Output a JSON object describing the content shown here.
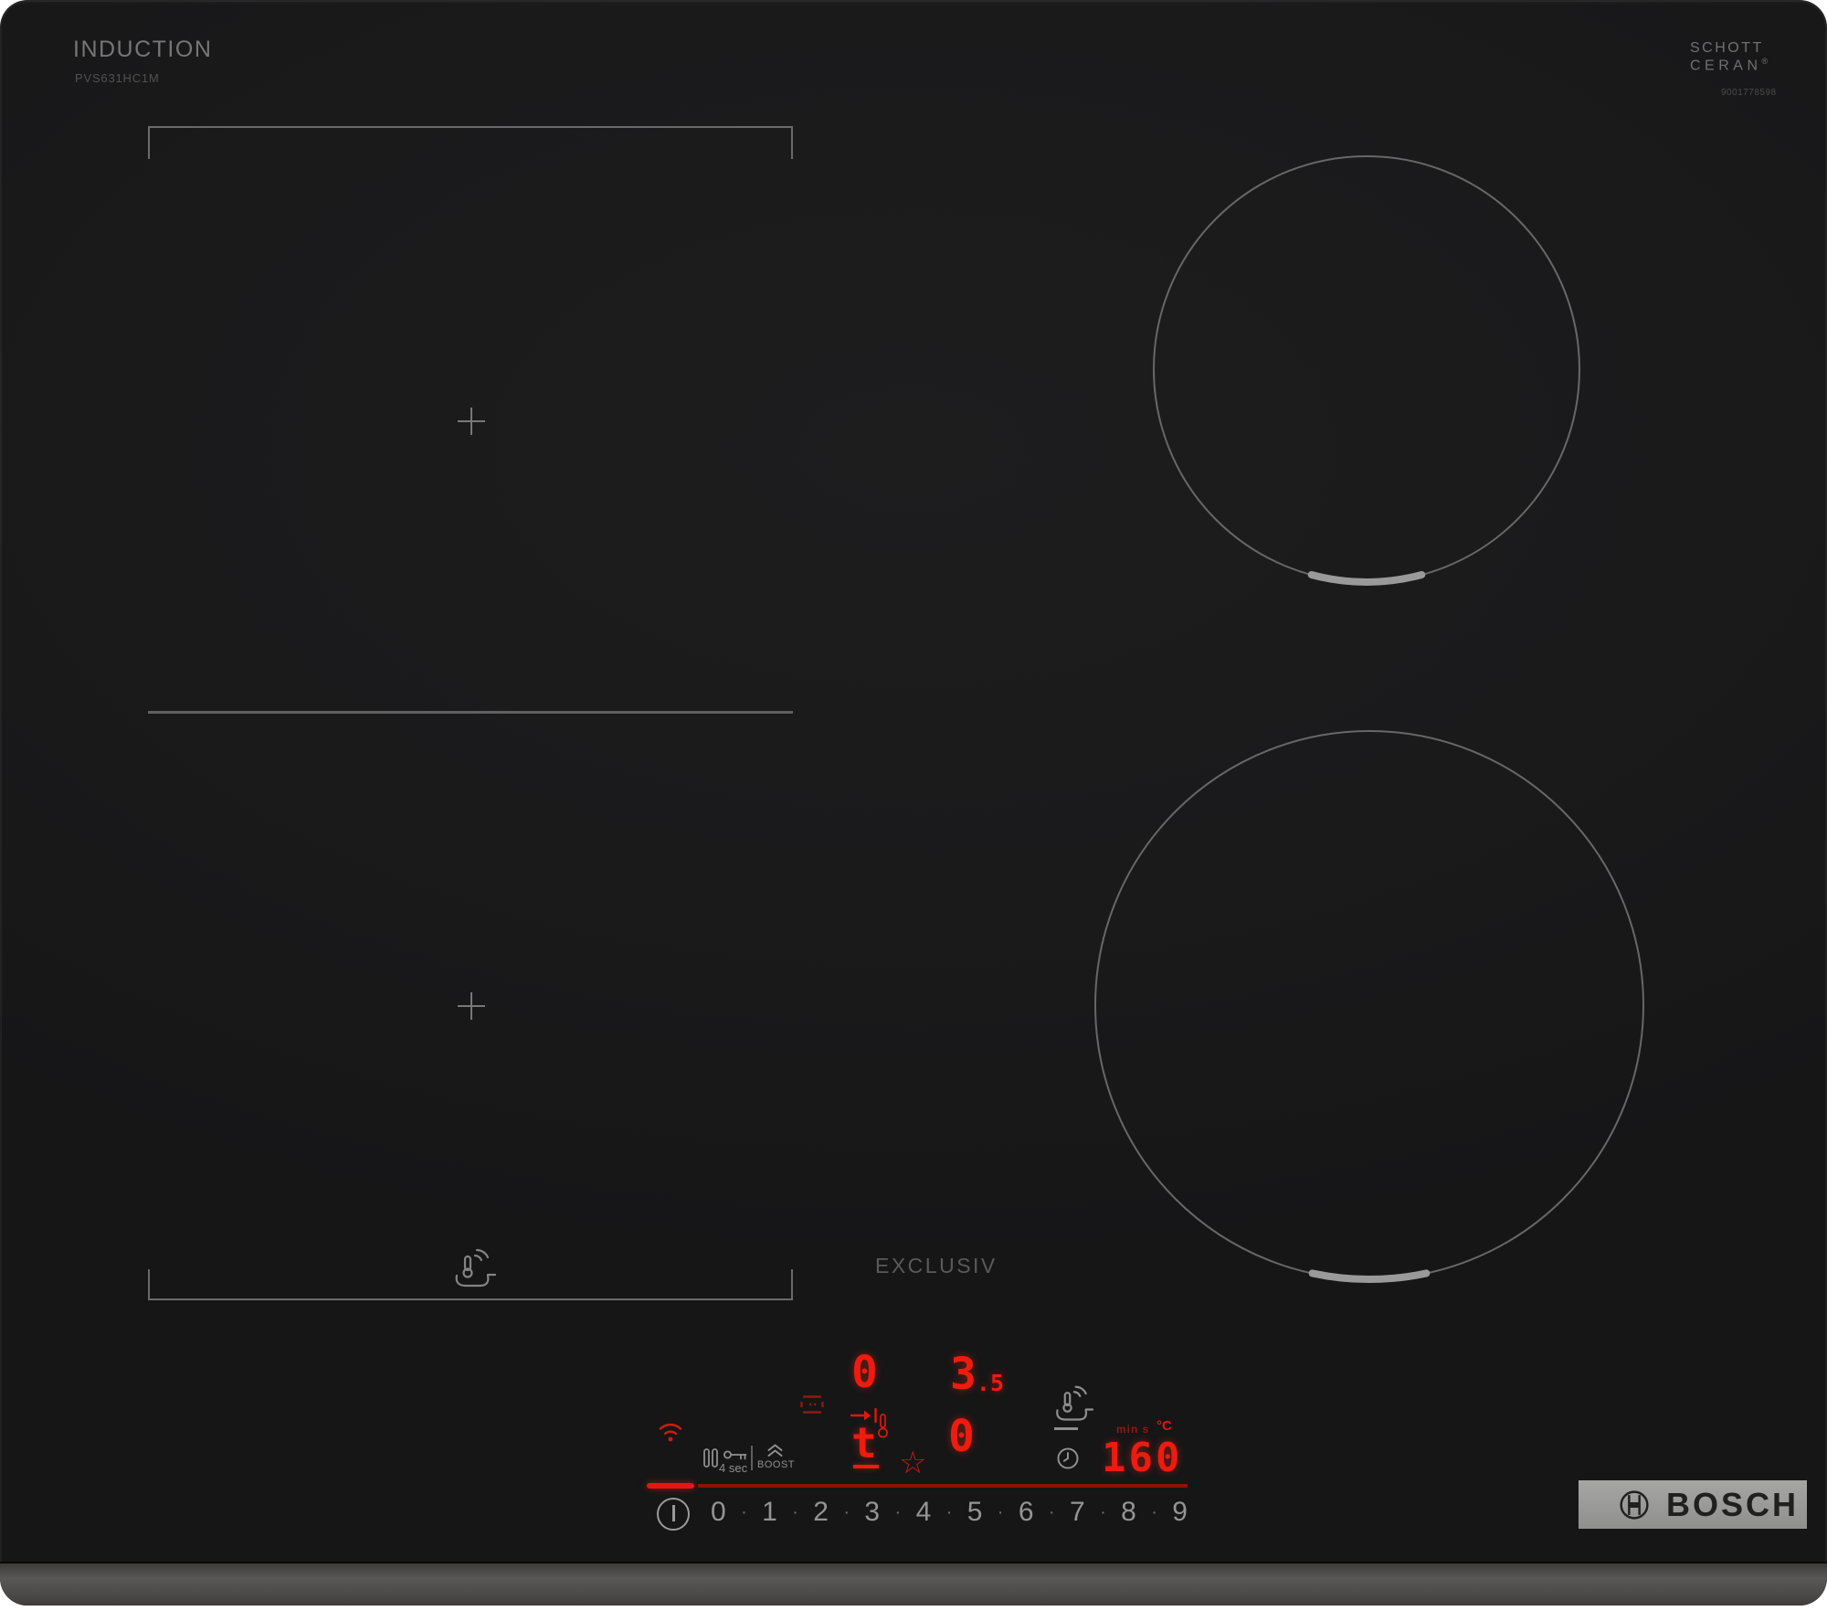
{
  "branding": {
    "type_label": "INDUCTION",
    "model": "PVS631HC1M",
    "glass_brand_line1": "SCHOTT",
    "glass_brand_line2": "CERAN",
    "glass_brand_reg": "®",
    "serial": "9001778598",
    "series_label": "EXCLUSIV",
    "maker": "BOSCH"
  },
  "controls": {
    "lock_delay_label": "4 sec",
    "boost_label": "BOOST",
    "digits": [
      "0",
      "1",
      "2",
      "3",
      "4",
      "5",
      "6",
      "7",
      "8",
      "9"
    ],
    "dot": "·"
  },
  "led_display": {
    "zone_front_left_level": "0",
    "zone_front_right_level_int": "3",
    "zone_front_right_level_frac": ".5",
    "flex_zone_char": "t",
    "zone_rear_right_level": "0",
    "timer_value": "160",
    "timer_unit_time": "min s",
    "timer_unit_temp": "°C",
    "star_glyph": "☆"
  },
  "colors": {
    "glass_black": "#1a1a1b",
    "led_red": "#ee1b0e",
    "led_red_dim": "#8a130b",
    "zone_outline_gray": "#6a6a6a",
    "control_gray": "#8f8f8f",
    "banner_gray": "#9b9b9a"
  }
}
